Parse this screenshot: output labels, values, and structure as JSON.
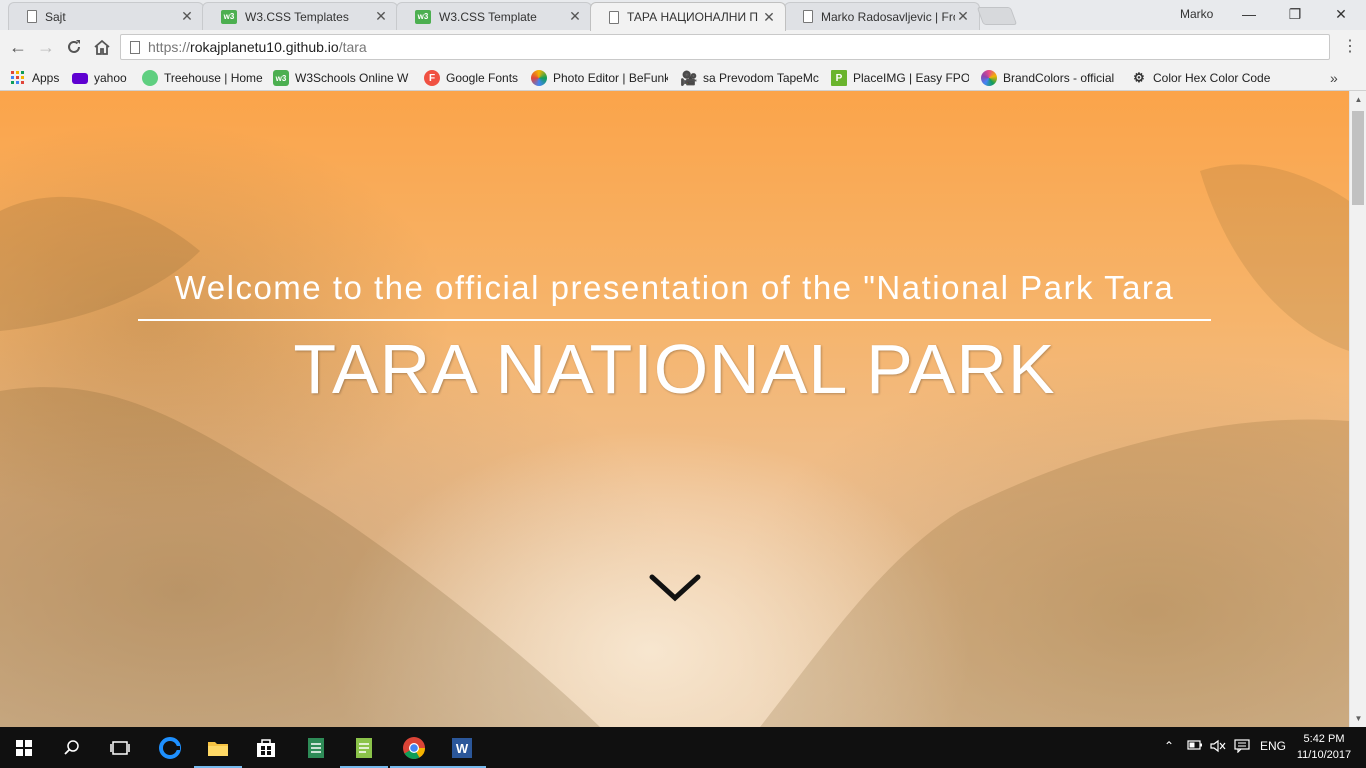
{
  "browser": {
    "tabs": [
      {
        "title": "Sajt",
        "icon": "page-icon",
        "active": false
      },
      {
        "title": "W3.CSS Templates",
        "icon": "w3schools-icon",
        "active": false
      },
      {
        "title": "W3.CSS Template",
        "icon": "w3schools-icon",
        "active": false
      },
      {
        "title": "ТАРА НАЦИОНАЛНИ П",
        "icon": "page-icon",
        "active": true
      },
      {
        "title": "Marko Radosavljevic | Fro",
        "icon": "page-icon",
        "active": false
      }
    ],
    "profile_name": "Marko",
    "url": {
      "scheme": "https://",
      "host": "rokajplanetu10.github.io",
      "path": "/tara"
    },
    "bookmarks": [
      {
        "label": "Apps",
        "icon": "apps-grid-icon",
        "color": "#e0453a"
      },
      {
        "label": "yahoo",
        "icon": "yahoo-mail-icon",
        "color": "#5f01d1"
      },
      {
        "label": "Treehouse | Home",
        "icon": "treehouse-icon",
        "color": "#5fcf80"
      },
      {
        "label": "W3Schools Online W",
        "icon": "w3schools-icon",
        "color": "#4CAF50"
      },
      {
        "label": "Google Fonts",
        "icon": "google-fonts-icon",
        "color": "#f05142"
      },
      {
        "label": "Photo Editor | BeFunk",
        "icon": "befunky-icon",
        "color": "#444444"
      },
      {
        "label": "sa Prevodom TapeMc",
        "icon": "film-camera-icon",
        "color": "#111111"
      },
      {
        "label": "PlaceIMG | Easy FPO",
        "icon": "placeimg-icon",
        "color": "#6ab42d"
      },
      {
        "label": "BrandColors - official",
        "icon": "brandcolors-icon",
        "color": "#e64a8a"
      },
      {
        "label": "Color Hex Color Code",
        "icon": "color-picker-icon",
        "color": "#333333"
      }
    ]
  },
  "page": {
    "subtitle": "Welcome to the official presentation of the \"National Park Tara",
    "title": "TARA NATIONAL PARK",
    "scroll_icon": "chevron-down-icon",
    "accent_color": "#fba44a"
  },
  "taskbar": {
    "apps": [
      {
        "name": "start",
        "icon": "windows-start-icon"
      },
      {
        "name": "search",
        "icon": "search-icon"
      },
      {
        "name": "task-view",
        "icon": "task-view-icon"
      },
      {
        "name": "edge",
        "icon": "edge-icon"
      },
      {
        "name": "file-explorer",
        "icon": "folder-icon"
      },
      {
        "name": "store",
        "icon": "store-icon"
      },
      {
        "name": "notepad-plus",
        "icon": "notepad-icon"
      },
      {
        "name": "editor",
        "icon": "editor-icon"
      },
      {
        "name": "chrome",
        "icon": "chrome-icon"
      },
      {
        "name": "word",
        "icon": "word-icon"
      }
    ],
    "language": "ENG",
    "time": "5:42 PM",
    "date": "11/10/2017"
  }
}
